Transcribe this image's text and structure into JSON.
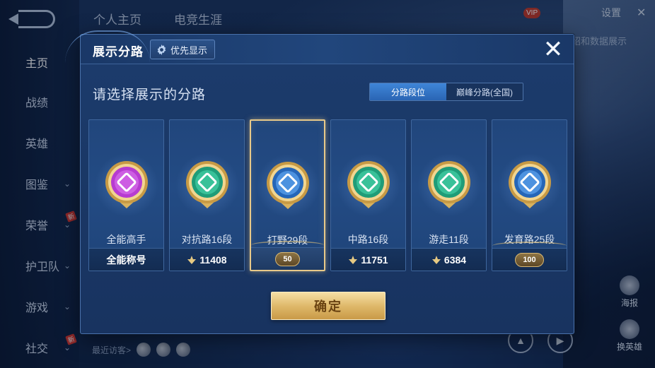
{
  "background": {
    "sidebar": [
      {
        "label": "主页",
        "active": true,
        "chevron": false,
        "new": false
      },
      {
        "label": "战绩",
        "active": false,
        "chevron": false,
        "new": false
      },
      {
        "label": "英雄",
        "active": false,
        "chevron": false,
        "new": false
      },
      {
        "label": "图鉴",
        "active": false,
        "chevron": true,
        "new": false
      },
      {
        "label": "荣誉",
        "active": false,
        "chevron": true,
        "new": true
      },
      {
        "label": "护卫队",
        "active": false,
        "chevron": true,
        "new": false
      },
      {
        "label": "游戏",
        "active": false,
        "chevron": true,
        "new": false
      },
      {
        "label": "社交",
        "active": false,
        "chevron": true,
        "new": true
      }
    ],
    "new_tag": "新",
    "top_tabs": [
      "个人主页",
      "电竞生涯"
    ],
    "settings_label": "设置",
    "vip_label": "VIP",
    "hint_text": "绍和数据展示",
    "recent_visitors_label": "最近访客>",
    "right_float": [
      {
        "label": "海报",
        "icon": "poster-icon"
      },
      {
        "label": "换英雄",
        "icon": "swap-hero-icon"
      }
    ]
  },
  "dialog": {
    "title": "展示分路",
    "priority_button": {
      "label": "优先显示",
      "icon": "gear-icon"
    },
    "close_icon": "close-icon",
    "subtitle": "请选择展示的分路",
    "segments": [
      {
        "label": "分路段位",
        "active": true
      },
      {
        "label": "巅峰分路(全国)",
        "active": false
      }
    ],
    "cards": [
      {
        "name": "全能高手",
        "footer": "全能称号",
        "footer_type": "text",
        "badge_color": "#b73bd1",
        "badge_inner": "#e07bf2",
        "selected": false
      },
      {
        "name": "对抗路16段",
        "footer": "11408",
        "footer_type": "power",
        "badge_color": "#1f9c78",
        "badge_inner": "#4fe0b4",
        "selected": false
      },
      {
        "name": "打野29段",
        "footer": "50",
        "footer_type": "level",
        "badge_color": "#2566b8",
        "badge_inner": "#6fb6ff",
        "selected": true
      },
      {
        "name": "中路16段",
        "footer": "11751",
        "footer_type": "power",
        "badge_color": "#1f9c78",
        "badge_inner": "#4fe0b4",
        "selected": false
      },
      {
        "name": "游走11段",
        "footer": "6384",
        "footer_type": "power",
        "badge_color": "#1f9c78",
        "badge_inner": "#4fe0b4",
        "selected": false
      },
      {
        "name": "发育路25段",
        "footer": "100",
        "footer_type": "level",
        "badge_color": "#2566b8",
        "badge_inner": "#6fb6ff",
        "selected": false
      }
    ],
    "confirm_label": "确定"
  },
  "colors": {
    "gold": "#e8c989",
    "accent_blue": "#3f86d8",
    "panel": "#1c3c6d"
  }
}
